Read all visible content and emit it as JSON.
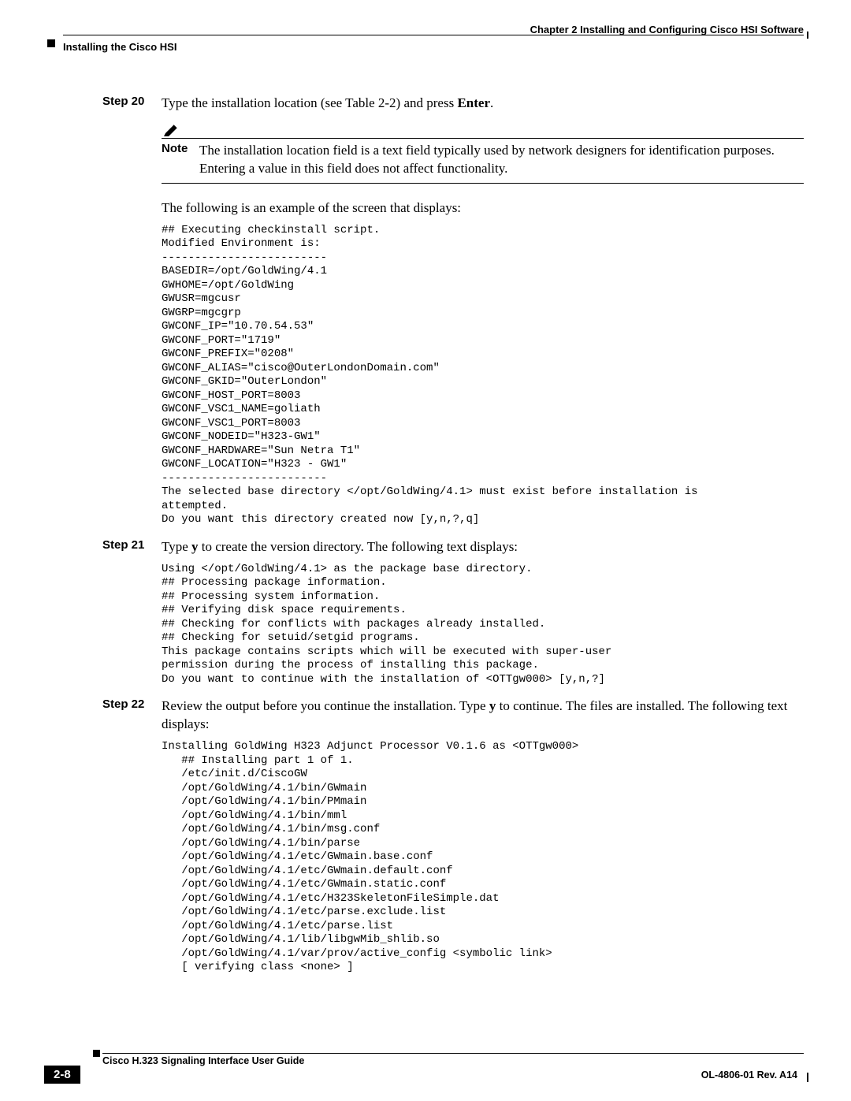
{
  "header": {
    "chapter": "Chapter 2      Installing and Configuring Cisco HSI Software",
    "section": "Installing the Cisco HSI"
  },
  "steps": {
    "s20": {
      "label": "Step 20",
      "text_pre": "Type the installation location (see Table 2-2) and press ",
      "text_bold": "Enter",
      "text_post": "."
    },
    "s21": {
      "label": "Step 21",
      "text_pre": "Type ",
      "text_bold": "y",
      "text_post": " to create the version directory. The following text displays:"
    },
    "s22": {
      "label": "Step 22",
      "text_pre": "Review the output before you continue the installation. Type ",
      "text_bold": "y",
      "text_post": " to continue. The files are installed. The following text displays:"
    }
  },
  "note": {
    "label": "Note",
    "text": "The installation location field is a text field typically used by network designers for identification purposes. Entering a value in this field does not affect functionality."
  },
  "para_example": "The following is an example of the screen that displays:",
  "code1": "## Executing checkinstall script.\nModified Environment is:\n-------------------------\nBASEDIR=/opt/GoldWing/4.1\nGWHOME=/opt/GoldWing\nGWUSR=mgcusr\nGWGRP=mgcgrp\nGWCONF_IP=\"10.70.54.53\"\nGWCONF_PORT=\"1719\"\nGWCONF_PREFIX=\"0208\"\nGWCONF_ALIAS=\"cisco@OuterLondonDomain.com\"\nGWCONF_GKID=\"OuterLondon\"\nGWCONF_HOST_PORT=8003\nGWCONF_VSC1_NAME=goliath\nGWCONF_VSC1_PORT=8003\nGWCONF_NODEID=\"H323-GW1\"\nGWCONF_HARDWARE=\"Sun Netra T1\"\nGWCONF_LOCATION=\"H323 - GW1\"\n-------------------------\nThe selected base directory </opt/GoldWing/4.1> must exist before installation is\nattempted.\nDo you want this directory created now [y,n,?,q]",
  "code2": "Using </opt/GoldWing/4.1> as the package base directory.\n## Processing package information.\n## Processing system information.\n## Verifying disk space requirements.\n## Checking for conflicts with packages already installed.\n## Checking for setuid/setgid programs.\nThis package contains scripts which will be executed with super-user\npermission during the process of installing this package.\nDo you want to continue with the installation of <OTTgw000> [y,n,?]",
  "code3": "Installing GoldWing H323 Adjunct Processor V0.1.6 as <OTTgw000>\n   ## Installing part 1 of 1.\n   /etc/init.d/CiscoGW\n   /opt/GoldWing/4.1/bin/GWmain\n   /opt/GoldWing/4.1/bin/PMmain\n   /opt/GoldWing/4.1/bin/mml\n   /opt/GoldWing/4.1/bin/msg.conf\n   /opt/GoldWing/4.1/bin/parse\n   /opt/GoldWing/4.1/etc/GWmain.base.conf\n   /opt/GoldWing/4.1/etc/GWmain.default.conf\n   /opt/GoldWing/4.1/etc/GWmain.static.conf\n   /opt/GoldWing/4.1/etc/H323SkeletonFileSimple.dat\n   /opt/GoldWing/4.1/etc/parse.exclude.list\n   /opt/GoldWing/4.1/etc/parse.list\n   /opt/GoldWing/4.1/lib/libgwMib_shlib.so\n   /opt/GoldWing/4.1/var/prov/active_config <symbolic link>\n   [ verifying class <none> ]",
  "footer": {
    "title": "Cisco H.323 Signaling Interface User Guide",
    "page": "2-8",
    "rev": "OL-4806-01 Rev. A14"
  }
}
